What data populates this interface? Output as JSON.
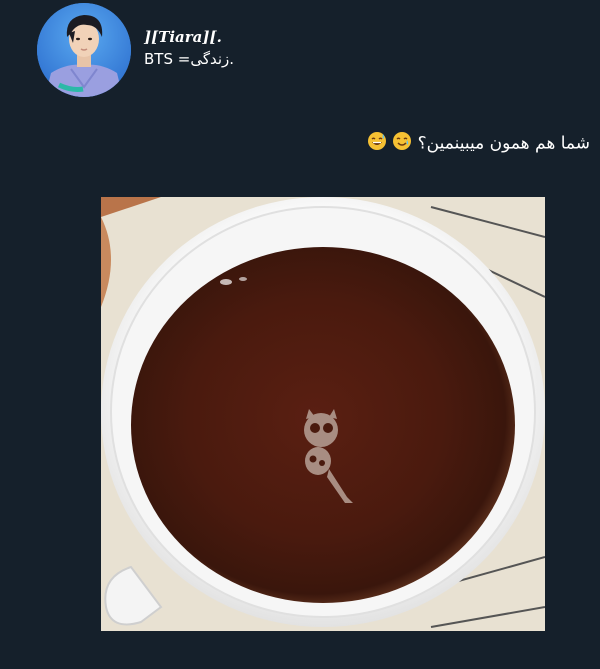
{
  "author": {
    "display_name": "][Tiara][.",
    "handle": "BTS =زندگی."
  },
  "tweet": {
    "text": "شما هم همون میبینمین؟",
    "emojis": [
      "smiling-face-with-tear-emoji",
      "grinning-sweat-emoji"
    ]
  },
  "media": {
    "description_icon": "tea-cup-photo"
  },
  "colors": {
    "background": "#15202b",
    "text": "#ffffff"
  }
}
